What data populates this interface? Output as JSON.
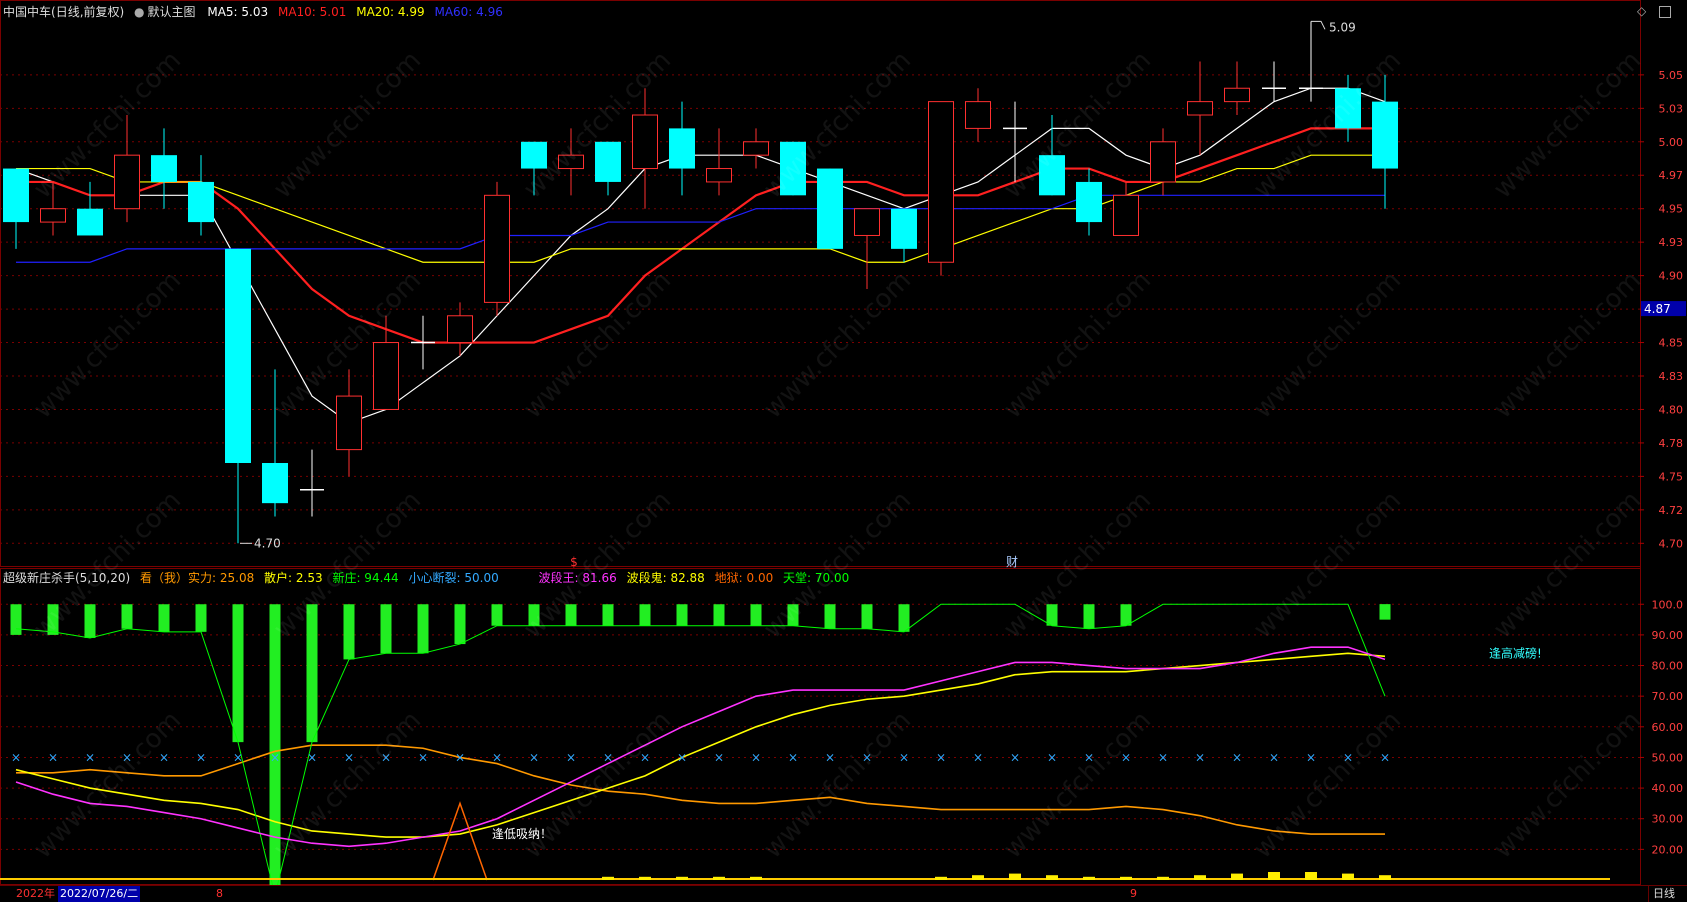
{
  "main_header": {
    "stock": "中国中车",
    "period": "(日线,前复权)",
    "circle_icon": "circle-icon",
    "chart_name": "默认主图",
    "ma": [
      {
        "label": "MA5: 5.03",
        "color": "#ffffff"
      },
      {
        "label": "MA10: 5.01",
        "color": "#ff2020"
      },
      {
        "label": "MA20: 4.99",
        "color": "#ffff00"
      },
      {
        "label": "MA60: 4.96",
        "color": "#2020ff"
      }
    ]
  },
  "window_icons": {
    "diamond": "◇",
    "restore": "restore-icon"
  },
  "indicator_header": {
    "name": "超级新庄杀手(5,10,20)",
    "items": [
      {
        "label": "看（我）实力: 25.08",
        "color": "#ff9900"
      },
      {
        "label": "散户: 2.53",
        "color": "#ffff00"
      },
      {
        "label": "新庄: 94.44",
        "color": "#00ff00"
      },
      {
        "label": "小心断裂: 50.00",
        "color": "#33aaff"
      },
      {
        "label": "波段王: 81.66",
        "color": "#ff33ff"
      },
      {
        "label": "波段鬼: 82.88",
        "color": "#ffff00"
      },
      {
        "label": "地狱: 0.00",
        "color": "#ff6600"
      },
      {
        "label": "天堂: 70.00",
        "color": "#00ff00"
      }
    ]
  },
  "chart_data": [
    {
      "type": "candlestick",
      "title": "中国中车 (日线,前复权)",
      "ylim": [
        4.695,
        5.088
      ],
      "y_ticks": [
        "5.05",
        "5.03",
        "5.00",
        "4.97",
        "4.95",
        "4.93",
        "4.90",
        "4.88",
        "4.85",
        "4.83",
        "4.80",
        "4.78",
        "4.75",
        "4.72",
        "4.70"
      ],
      "y_tick_values": [
        5.05,
        5.025,
        5.0,
        4.975,
        4.95,
        4.925,
        4.9,
        4.875,
        4.85,
        4.825,
        4.8,
        4.775,
        4.75,
        4.725,
        4.7
      ],
      "current_price": "4.87",
      "annotations": {
        "high": "5.09",
        "low": "4.70",
        "event_markers": [
          "$",
          "财"
        ]
      },
      "candles": [
        {
          "o": 4.98,
          "h": 4.98,
          "l": 4.92,
          "c": 4.94
        },
        {
          "o": 4.94,
          "h": 4.97,
          "l": 4.93,
          "c": 4.95
        },
        {
          "o": 4.95,
          "h": 4.97,
          "l": 4.93,
          "c": 4.93
        },
        {
          "o": 4.95,
          "h": 5.02,
          "l": 4.94,
          "c": 4.99
        },
        {
          "o": 4.99,
          "h": 5.01,
          "l": 4.95,
          "c": 4.97
        },
        {
          "o": 4.97,
          "h": 4.99,
          "l": 4.93,
          "c": 4.94
        },
        {
          "o": 4.92,
          "h": 4.92,
          "l": 4.7,
          "c": 4.76
        },
        {
          "o": 4.76,
          "h": 4.83,
          "l": 4.72,
          "c": 4.73
        },
        {
          "o": 4.74,
          "h": 4.77,
          "l": 4.72,
          "c": 4.74
        },
        {
          "o": 4.77,
          "h": 4.83,
          "l": 4.75,
          "c": 4.81
        },
        {
          "o": 4.8,
          "h": 4.87,
          "l": 4.8,
          "c": 4.85
        },
        {
          "o": 4.85,
          "h": 4.87,
          "l": 4.83,
          "c": 4.85
        },
        {
          "o": 4.85,
          "h": 4.88,
          "l": 4.84,
          "c": 4.87
        },
        {
          "o": 4.88,
          "h": 4.97,
          "l": 4.87,
          "c": 4.96
        },
        {
          "o": 5.0,
          "h": 5.0,
          "l": 4.96,
          "c": 4.98
        },
        {
          "o": 4.98,
          "h": 5.01,
          "l": 4.96,
          "c": 4.99
        },
        {
          "o": 5.0,
          "h": 5.0,
          "l": 4.96,
          "c": 4.97
        },
        {
          "o": 4.98,
          "h": 5.04,
          "l": 4.95,
          "c": 5.02
        },
        {
          "o": 5.01,
          "h": 5.03,
          "l": 4.96,
          "c": 4.98
        },
        {
          "o": 4.97,
          "h": 5.01,
          "l": 4.96,
          "c": 4.98
        },
        {
          "o": 4.99,
          "h": 5.01,
          "l": 4.98,
          "c": 5.0
        },
        {
          "o": 5.0,
          "h": 5.0,
          "l": 4.96,
          "c": 4.96
        },
        {
          "o": 4.98,
          "h": 4.98,
          "l": 4.92,
          "c": 4.92
        },
        {
          "o": 4.93,
          "h": 4.95,
          "l": 4.89,
          "c": 4.95
        },
        {
          "o": 4.95,
          "h": 4.95,
          "l": 4.91,
          "c": 4.92
        },
        {
          "o": 4.91,
          "h": 5.03,
          "l": 4.9,
          "c": 5.03
        },
        {
          "o": 5.01,
          "h": 5.04,
          "l": 5.0,
          "c": 5.03
        },
        {
          "o": 5.01,
          "h": 5.03,
          "l": 4.97,
          "c": 5.01
        },
        {
          "o": 4.99,
          "h": 5.02,
          "l": 4.96,
          "c": 4.96
        },
        {
          "o": 4.97,
          "h": 4.98,
          "l": 4.93,
          "c": 4.94
        },
        {
          "o": 4.93,
          "h": 4.97,
          "l": 4.93,
          "c": 4.96
        },
        {
          "o": 4.97,
          "h": 5.01,
          "l": 4.96,
          "c": 5.0
        },
        {
          "o": 5.02,
          "h": 5.06,
          "l": 4.99,
          "c": 5.03
        },
        {
          "o": 5.03,
          "h": 5.06,
          "l": 5.02,
          "c": 5.04
        },
        {
          "o": 5.04,
          "h": 5.06,
          "l": 5.03,
          "c": 5.04
        },
        {
          "o": 5.04,
          "h": 5.09,
          "l": 5.03,
          "c": 5.04
        },
        {
          "o": 5.04,
          "h": 5.05,
          "l": 5.0,
          "c": 5.01
        },
        {
          "o": 5.03,
          "h": 5.05,
          "l": 4.95,
          "c": 4.98
        }
      ],
      "series": [
        {
          "name": "MA5",
          "color": "#ffffff",
          "values": [
            4.98,
            4.97,
            4.96,
            4.96,
            4.96,
            4.96,
            4.91,
            4.86,
            4.81,
            4.79,
            4.8,
            4.82,
            4.84,
            4.87,
            4.9,
            4.93,
            4.95,
            4.98,
            4.99,
            4.99,
            4.99,
            4.98,
            4.97,
            4.96,
            4.95,
            4.96,
            4.97,
            4.99,
            5.01,
            5.01,
            4.99,
            4.98,
            4.99,
            5.01,
            5.03,
            5.04,
            5.04,
            5.03
          ]
        },
        {
          "name": "MA10",
          "color": "#ff2020",
          "values": [
            4.97,
            4.97,
            4.96,
            4.96,
            4.97,
            4.97,
            4.95,
            4.92,
            4.89,
            4.87,
            4.86,
            4.85,
            4.85,
            4.85,
            4.85,
            4.86,
            4.87,
            4.9,
            4.92,
            4.94,
            4.96,
            4.97,
            4.97,
            4.97,
            4.96,
            4.96,
            4.96,
            4.97,
            4.98,
            4.98,
            4.97,
            4.97,
            4.98,
            4.99,
            5.0,
            5.01,
            5.01,
            5.01
          ]
        },
        {
          "name": "MA20",
          "color": "#ffff00",
          "values": [
            4.98,
            4.98,
            4.98,
            4.97,
            4.97,
            4.97,
            4.96,
            4.95,
            4.94,
            4.93,
            4.92,
            4.91,
            4.91,
            4.91,
            4.91,
            4.92,
            4.92,
            4.92,
            4.92,
            4.92,
            4.92,
            4.92,
            4.92,
            4.91,
            4.91,
            4.92,
            4.93,
            4.94,
            4.95,
            4.95,
            4.96,
            4.97,
            4.97,
            4.98,
            4.98,
            4.99,
            4.99,
            4.99
          ]
        },
        {
          "name": "MA60",
          "color": "#2020ff",
          "values": [
            4.91,
            4.91,
            4.91,
            4.92,
            4.92,
            4.92,
            4.92,
            4.92,
            4.92,
            4.92,
            4.92,
            4.92,
            4.92,
            4.93,
            4.93,
            4.93,
            4.94,
            4.94,
            4.94,
            4.94,
            4.95,
            4.95,
            4.95,
            4.95,
            4.95,
            4.95,
            4.95,
            4.95,
            4.95,
            4.96,
            4.96,
            4.96,
            4.96,
            4.96,
            4.96,
            4.96,
            4.96,
            4.96
          ]
        }
      ]
    },
    {
      "type": "line",
      "title": "超级新庄杀手(5,10,20)",
      "ylim": [
        10,
        104
      ],
      "y_ticks": [
        "100.0",
        "90.00",
        "80.00",
        "70.00",
        "60.00",
        "50.00",
        "40.00",
        "30.00",
        "20.00"
      ],
      "y_tick_values": [
        100,
        90,
        80,
        70,
        60,
        50,
        40,
        30,
        20
      ],
      "annotations": [
        "逢低吸纳！",
        "逢高减磅!"
      ],
      "green_bars": [
        90,
        90,
        89,
        92,
        91,
        91,
        55,
        5,
        55,
        82,
        84,
        84,
        87,
        93,
        93,
        93,
        93,
        93,
        93,
        93,
        93,
        93,
        92,
        92,
        91,
        100,
        100,
        100,
        93,
        92,
        93,
        100,
        100,
        100,
        100,
        100,
        100,
        95
      ],
      "series": [
        {
          "name": "实力",
          "color": "#ff9900",
          "values": [
            45,
            45,
            46,
            45,
            44,
            44,
            48,
            52,
            54,
            54,
            54,
            53,
            50,
            48,
            44,
            41,
            39,
            38,
            36,
            35,
            35,
            36,
            37,
            35,
            34,
            33,
            33,
            33,
            33,
            33,
            34,
            33,
            31,
            28,
            26,
            25,
            25,
            25
          ]
        },
        {
          "name": "散户",
          "color": "#ffff00",
          "values": [
            46,
            43,
            40,
            38,
            36,
            35,
            33,
            29,
            26,
            25,
            24,
            24,
            25,
            28,
            32,
            36,
            40,
            44,
            50,
            55,
            60,
            64,
            67,
            69,
            70,
            72,
            74,
            77,
            78,
            78,
            78,
            79,
            80,
            81,
            82,
            83,
            84,
            83
          ]
        },
        {
          "name": "新庄",
          "color": "#00ff00",
          "values": [
            92,
            91,
            89,
            92,
            91,
            91,
            55,
            5,
            55,
            82,
            84,
            84,
            87,
            93,
            93,
            93,
            93,
            93,
            93,
            93,
            93,
            93,
            92,
            92,
            91,
            100,
            100,
            100,
            93,
            92,
            93,
            100,
            100,
            100,
            100,
            100,
            100,
            70
          ]
        },
        {
          "name": "小心断裂",
          "color": "#33aaff",
          "values": [
            50,
            50,
            50,
            50,
            50,
            50,
            50,
            50,
            50,
            50,
            50,
            50,
            50,
            50,
            50,
            50,
            50,
            50,
            50,
            50,
            50,
            50,
            50,
            50,
            50,
            50,
            50,
            50,
            50,
            50,
            50,
            50,
            50,
            50,
            50,
            50,
            50,
            50
          ]
        },
        {
          "name": "波段王",
          "color": "#ff33ff",
          "values": [
            42,
            38,
            35,
            34,
            32,
            30,
            27,
            24,
            22,
            21,
            22,
            24,
            26,
            30,
            36,
            42,
            48,
            54,
            60,
            65,
            70,
            72,
            72,
            72,
            72,
            75,
            78,
            81,
            81,
            80,
            79,
            79,
            79,
            81,
            84,
            86,
            86,
            82
          ]
        },
        {
          "name": "波段鬼",
          "color": "#ffff00",
          "values": [
            null
          ]
        },
        {
          "name": "地狱",
          "color": "#ff6600",
          "spike_index": 12,
          "values": [
            0,
            0,
            0,
            0,
            0,
            0,
            0,
            0,
            0,
            0,
            0,
            0,
            35,
            0,
            0,
            0,
            0,
            0,
            0,
            0,
            0,
            0,
            0,
            0,
            0,
            0,
            0,
            0,
            0,
            0,
            0,
            0,
            0,
            0,
            0,
            0,
            0,
            0
          ]
        },
        {
          "name": "天堂",
          "color": "#00ff00",
          "values": [
            70
          ]
        }
      ],
      "yellow_bars": [
        1,
        1,
        1,
        1,
        1,
        1,
        1,
        1,
        1,
        1,
        1,
        1,
        1,
        1,
        1,
        1,
        2,
        2,
        2,
        2,
        2,
        1,
        1,
        1,
        1,
        2,
        3,
        4,
        3,
        2,
        2,
        2,
        3,
        4,
        5,
        5,
        4,
        3
      ]
    }
  ],
  "bottom_bar": {
    "year": "2022年",
    "date": "2022/07/26/二",
    "m8": "8",
    "m9": "9",
    "period_tab": "日线"
  }
}
